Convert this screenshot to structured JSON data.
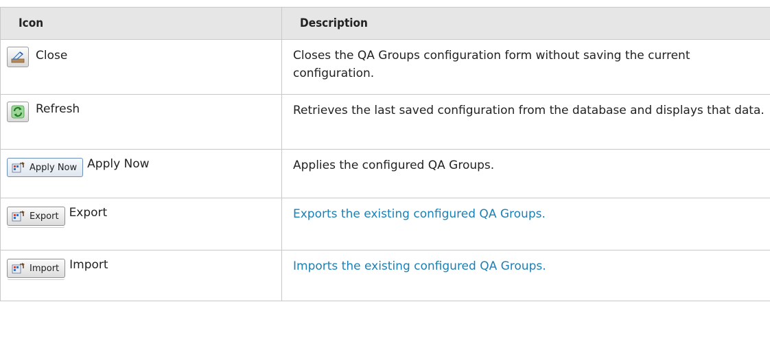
{
  "table": {
    "headers": {
      "icon": "Icon",
      "description": "Description"
    },
    "rows": [
      {
        "label": "Close",
        "description": "Closes the QA Groups configuration form without saving the current configuration.",
        "icon": "close-icon",
        "button_text": ""
      },
      {
        "label": "Refresh",
        "description": "Retrieves the last saved configuration from the database and displays that data.",
        "icon": "refresh-icon",
        "button_text": ""
      },
      {
        "label": "Apply Now",
        "description": "Applies the configured QA Groups.",
        "icon": "apply-now-icon",
        "button_text": "Apply Now"
      },
      {
        "label": "Export",
        "description": "Exports the existing configured QA Groups.",
        "icon": "export-icon",
        "button_text": "Export"
      },
      {
        "label": "Import",
        "description": "Imports the existing configured QA Groups.",
        "icon": "import-icon",
        "button_text": "Import"
      }
    ]
  },
  "colors": {
    "header_bg": "#e6e6e6",
    "link_text": "#1a80b6",
    "border": "#c8c8c8"
  }
}
